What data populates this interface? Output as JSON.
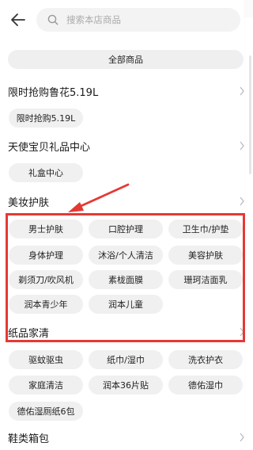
{
  "header": {
    "back_icon": "back-arrow-icon",
    "search_icon": "search-icon",
    "search_placeholder": "搜索本店商品"
  },
  "all_products_label": "全部商品",
  "categories": [
    {
      "title": "限时抢购鲁花5.19L",
      "chips": [
        "限时抢购5.19L"
      ]
    },
    {
      "title": "天使宝贝礼品中心",
      "chips": [
        "礼盒中心"
      ]
    },
    {
      "title": "美妆护肤",
      "chips": [
        "男士护肤",
        "口腔护理",
        "卫生巾/护垫",
        "身体护理",
        "沐浴/个人清洁",
        "美容护肤",
        "剃须刀/吹风机",
        "素栊面膜",
        "珊珂洁面乳",
        "润本青少年",
        "润本儿童"
      ]
    },
    {
      "title": "纸品家清",
      "chips": [
        "驱蚊驱虫",
        "纸巾/湿巾",
        "洗衣护衣",
        "家庭清洁",
        "润本36片贴",
        "德佑湿巾",
        "德佑湿厕纸6包"
      ]
    },
    {
      "title": "鞋类箱包",
      "chips": []
    }
  ],
  "annotation": {
    "color": "#e53935",
    "shape": "red-arrow-and-rectangle"
  },
  "colors": {
    "chip_bg": "#f0f0f0",
    "background": "#ffffff",
    "text": "#222222"
  }
}
